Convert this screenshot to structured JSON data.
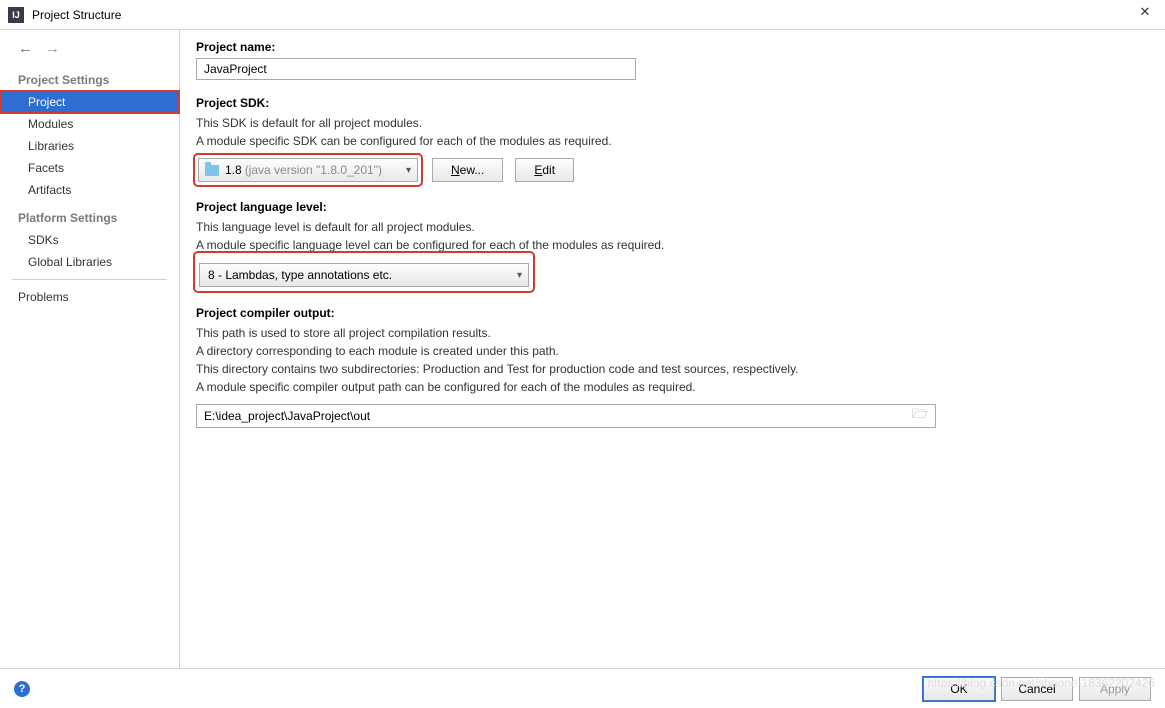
{
  "title": "Project Structure",
  "sidebar": {
    "project_settings_heading": "Project Settings",
    "platform_settings_heading": "Platform Settings",
    "items": {
      "project": "Project",
      "modules": "Modules",
      "libraries": "Libraries",
      "facets": "Facets",
      "artifacts": "Artifacts",
      "sdks": "SDKs",
      "global_libraries": "Global Libraries",
      "problems": "Problems"
    }
  },
  "project_name": {
    "label": "Project name:",
    "value": "JavaProject"
  },
  "project_sdk": {
    "label": "Project SDK:",
    "help1": "This SDK is default for all project modules.",
    "help2": "A module specific SDK can be configured for each of the modules as required.",
    "selected_version": "1.8",
    "selected_paren": "(java version \"1.8.0_201\")",
    "new_btn": "New...",
    "edit_btn": "Edit"
  },
  "project_lang": {
    "label": "Project language level:",
    "help1": "This language level is default for all project modules.",
    "help2": "A module specific language level can be configured for each of the modules as required.",
    "selected": "8 - Lambdas, type annotations etc."
  },
  "compiler_output": {
    "label": "Project compiler output:",
    "help1": "This path is used to store all project compilation results.",
    "help2": "A directory corresponding to each module is created under this path.",
    "help3": "This directory contains two subdirectories: Production and Test for production code and test sources, respectively.",
    "help4": "A module specific compiler output path can be configured for each of the modules as required.",
    "value": "E:\\idea_project\\JavaProject\\out"
  },
  "footer": {
    "ok": "OK",
    "cancel": "Cancel",
    "apply": "Apply"
  },
  "watermark": "https://blog.csdn.net/shaone-18362202426"
}
